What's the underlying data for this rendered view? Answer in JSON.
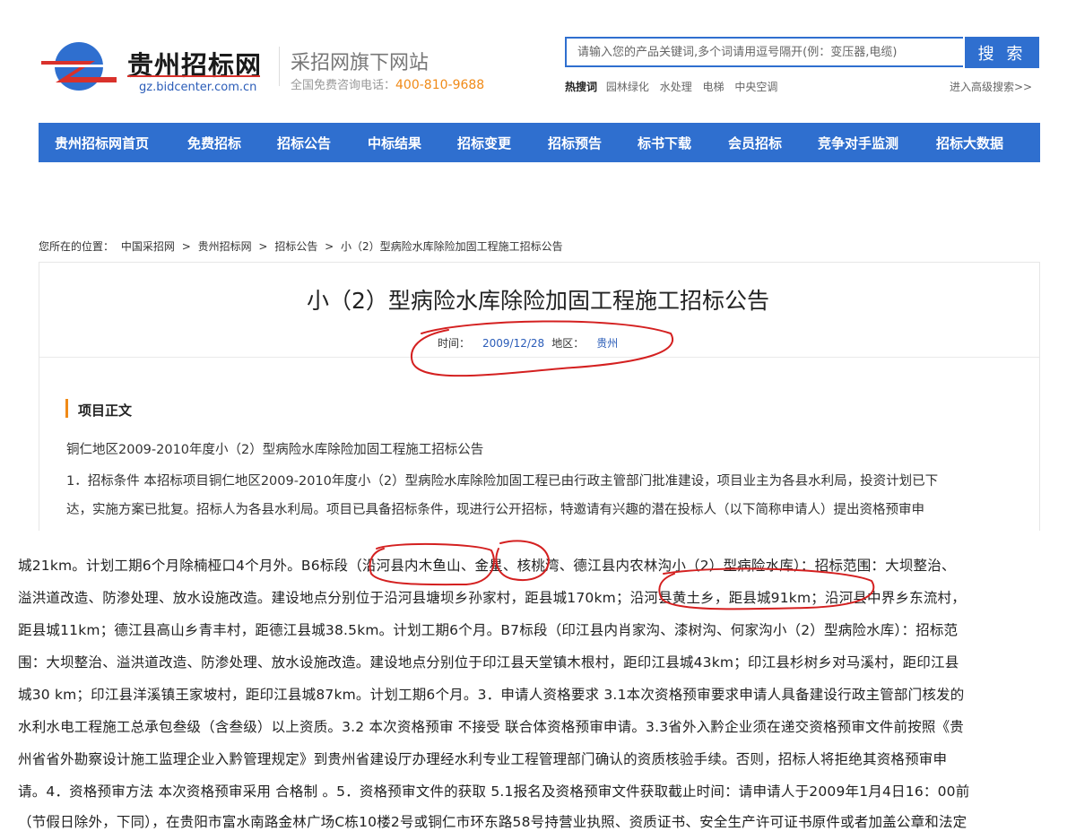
{
  "header": {
    "site_name": "贵州招标网",
    "site_domain": "gz.bidcenter.com.cn",
    "tagline": "采招网旗下网站",
    "phone_label": "全国免费咨询电话：",
    "phone_number": "400-810-9688",
    "search": {
      "placeholder": "请输入您的产品关键词,多个词请用逗号隔开(例：变压器,电缆)",
      "button_label": "搜 索"
    },
    "hot_label": "热搜词",
    "hot_words": [
      "园林绿化",
      "水处理",
      "电梯",
      "中央空调"
    ],
    "advanced_search": "进入高级搜索>>"
  },
  "nav": {
    "items": [
      "贵州招标网首页",
      "免费招标",
      "招标公告",
      "中标结果",
      "招标变更",
      "招标预告",
      "标书下载",
      "会员招标",
      "竞争对手监测",
      "招标大数据"
    ]
  },
  "breadcrumb": {
    "label": "您所在的位置：",
    "items": [
      "中国采招网",
      "贵州招标网",
      "招标公告",
      "小（2）型病险水库除险加固工程施工招标公告"
    ],
    "separator": ">"
  },
  "article": {
    "title": "小（2）型病险水库除险加固工程施工招标公告",
    "time_label": "时间：",
    "time_value": "2009/12/28",
    "region_label": "地区：",
    "region_value": "贵州",
    "section_heading": "项目正文",
    "paragraphs": [
      "铜仁地区2009-2010年度小（2）型病险水库除险加固工程施工招标公告",
      "1．招标条件 本招标项目铜仁地区2009-2010年度小（2）型病险水库除险加固工程已由行政主管部门批准建设，项目业主为各县水利局，投资计划已下",
      "达，实施方案已批复。招标人为各县水利局。项目已具备招标条件，现进行公开招标，特邀请有兴趣的潜在投标人（以下简称申请人）提出资格预审申"
    ]
  },
  "zoomed_text": {
    "lines": [
      "城21km。计划工期6个月除楠桠口4个月外。B6标段（沿河县内木鱼山、金星、核桃湾、德江县内农林沟小（2）型病险水库）：招标范围：大坝整治、",
      "溢洪道改造、防渗处理、放水设施改造。建设地点分别位于沿河县塘坝乡孙家村，距县城170km；沿河县黄土乡，距县城91km；沿河县中界乡东流村，",
      "距县城11km；德江县高山乡青丰村，距德江县城38.5km。计划工期6个月。B7标段（印江县内肖家沟、漆树沟、何家沟小（2）型病险水库）：招标范",
      "围：大坝整治、溢洪道改造、防渗处理、放水设施改造。建设地点分别位于印江县天堂镇木根村，距印江县城43km；印江县杉树乡对马溪村，距印江县",
      "城30 km；印江县洋溪镇王家坡村，距印江县城87km。计划工期6个月。3．申请人资格要求 3.1本次资格预审要求申请人具备建设行政主管部门核发的",
      "水利水电工程施工总承包叁级（含叁级）以上资质。3.2 本次资格预审 不接受 联合体资格预审申请。3.3省外入黔企业须在递交资格预审文件前按照《贵",
      "州省省外勘察设计施工监理企业入黔管理规定》到贵州省建设厅办理经水利专业工程管理部门确认的资质核验手续。否则，招标人将拒绝其资格预审申",
      "请。4．资格预审方法 本次资格预审采用 合格制 。5．资格预审文件的获取 5.1报名及资格预审文件获取截止时间：请申请人于2009年1月4日16：00前",
      "（节假日除外，下同），在贵阳市富水南路金林广场C栋10楼2号或铜仁市环东路58号持营业执照、资质证书、安全生产许可证书原件或者加盖公章和法定"
    ]
  },
  "colors": {
    "brand_blue": "#2f6fcf",
    "accent_orange": "#f08a17",
    "annotation_red": "#d42020"
  }
}
